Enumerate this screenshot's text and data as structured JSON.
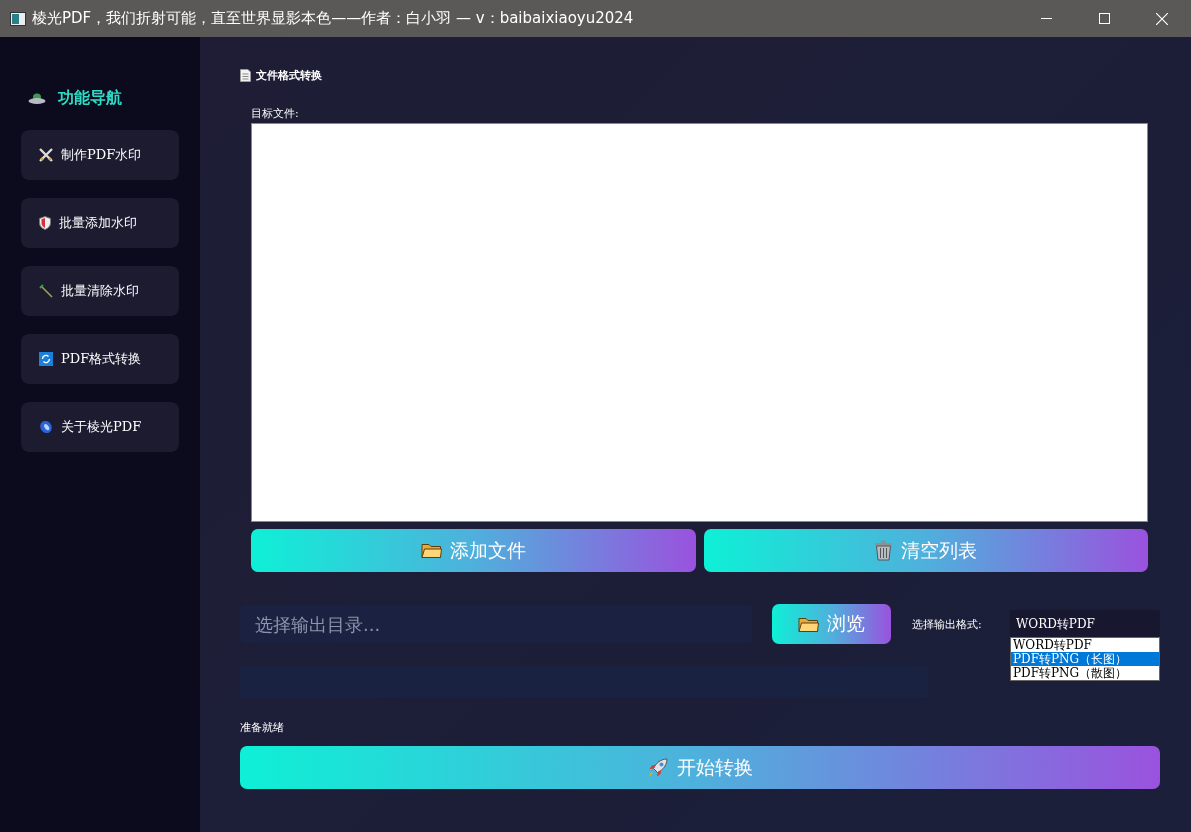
{
  "window": {
    "title": "棱光PDF，我们折射可能，直至世界显影本色——作者：白小羽 — v：baibaixiaoyu2024"
  },
  "sidebar": {
    "title": "功能导航",
    "items": [
      {
        "label": "制作PDF水印"
      },
      {
        "label": "批量添加水印"
      },
      {
        "label": "批量清除水印"
      },
      {
        "label": "PDF格式转换"
      },
      {
        "label": "关于棱光PDF"
      }
    ]
  },
  "main": {
    "heading": "文件格式转换",
    "file_list": {
      "label": "目标文件:"
    },
    "list_buttons": [
      {
        "label": "添加文件"
      },
      {
        "label": "清空列表"
      }
    ],
    "output_dir": {
      "placeholder": "选择输出目录..."
    },
    "browse_button": {
      "label": "浏览"
    },
    "format": {
      "label": "选择输出格式:",
      "value": "WORD转PDF",
      "options": [
        {
          "label": "WORD转PDF",
          "highlighted": false
        },
        {
          "label": "PDF转PNG（长图）",
          "highlighted": true
        },
        {
          "label": "PDF转PNG（散图）",
          "highlighted": false
        }
      ]
    },
    "progress": {
      "level": 0
    },
    "status": "准备就绪",
    "start_button": {
      "label": "开始转换"
    }
  }
}
